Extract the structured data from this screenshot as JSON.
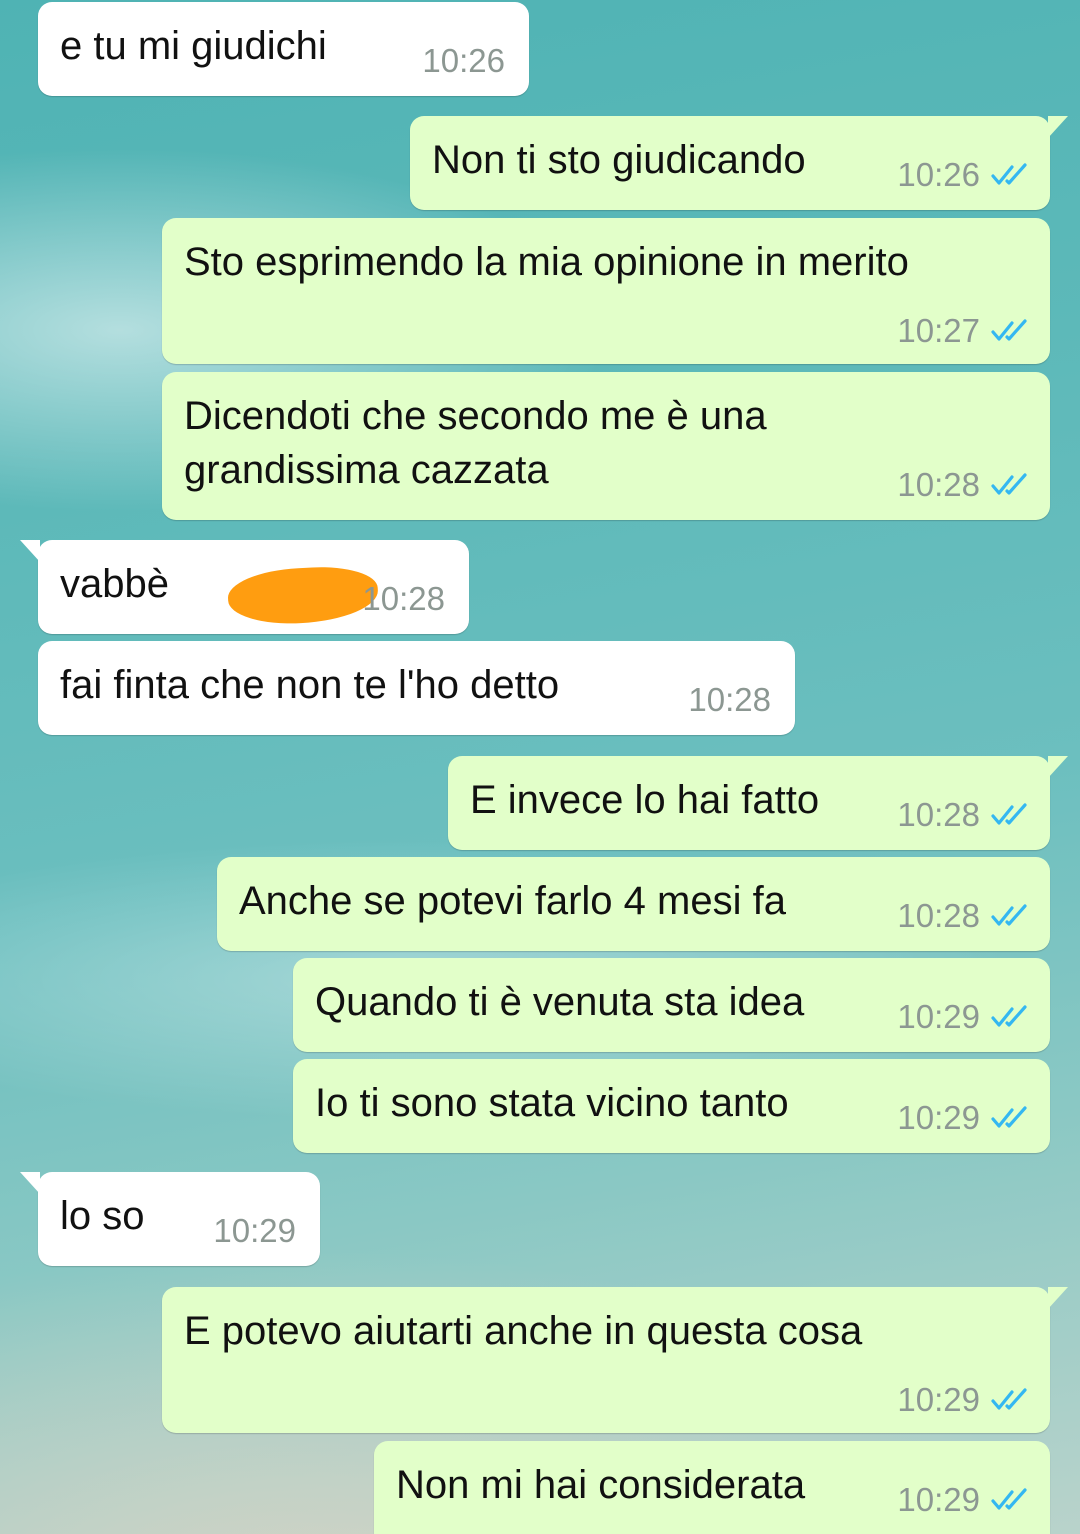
{
  "colors": {
    "incoming_bubble": "#ffffff",
    "outgoing_bubble": "#e2ffc9",
    "read_ticks": "#34b7f1",
    "redaction": "#ff9d10"
  },
  "messages": [
    {
      "text": "e tu mi giudichi",
      "time": "10:26",
      "direction": "incoming"
    },
    {
      "text": "Non ti sto giudicando",
      "time": "10:26",
      "direction": "outgoing",
      "status": "read"
    },
    {
      "text": "Sto esprimendo la mia opinione in merito",
      "time": "10:27",
      "direction": "outgoing",
      "status": "read"
    },
    {
      "text_line1": "Dicendoti che secondo me è una",
      "text_line2": "grandissima cazzata",
      "time": "10:28",
      "direction": "outgoing",
      "status": "read"
    },
    {
      "text": "vabbè",
      "time": "10:28",
      "direction": "incoming",
      "redacted": true
    },
    {
      "text": "fai finta che non te l'ho detto",
      "time": "10:28",
      "direction": "incoming"
    },
    {
      "text": "E invece lo hai fatto",
      "time": "10:28",
      "direction": "outgoing",
      "status": "read"
    },
    {
      "text": "Anche se potevi farlo 4 mesi fa",
      "time": "10:28",
      "direction": "outgoing",
      "status": "read"
    },
    {
      "text": "Quando ti è venuta sta idea",
      "time": "10:29",
      "direction": "outgoing",
      "status": "read"
    },
    {
      "text": "Io ti sono stata vicino tanto",
      "time": "10:29",
      "direction": "outgoing",
      "status": "read"
    },
    {
      "text": "lo so",
      "time": "10:29",
      "direction": "incoming"
    },
    {
      "text": "E potevo aiutarti anche in questa cosa",
      "time": "10:29",
      "direction": "outgoing",
      "status": "read"
    },
    {
      "text": "Non mi hai considerata",
      "time": "10:29",
      "direction": "outgoing",
      "status": "read"
    }
  ],
  "icons": {
    "read_receipt": "double-check-icon"
  }
}
